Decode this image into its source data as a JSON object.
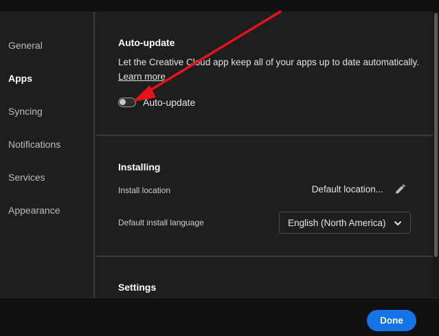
{
  "sidebar": {
    "items": [
      {
        "label": "General",
        "active": false
      },
      {
        "label": "Apps",
        "active": true
      },
      {
        "label": "Syncing",
        "active": false
      },
      {
        "label": "Notifications",
        "active": false
      },
      {
        "label": "Services",
        "active": false
      },
      {
        "label": "Appearance",
        "active": false
      }
    ]
  },
  "auto_update": {
    "title": "Auto-update",
    "description": "Let the Creative Cloud app keep all of your apps up to date automatically.",
    "learn_more": "Learn more",
    "toggle_label": "Auto-update",
    "toggle_on": false
  },
  "installing": {
    "title": "Installing",
    "install_location_label": "Install location",
    "install_location_value": "Default location...",
    "install_language_label": "Default install language",
    "install_language_value": "English (North America)"
  },
  "settings": {
    "title": "Settings"
  },
  "footer": {
    "done_label": "Done"
  },
  "colors": {
    "accent": "#1473e6",
    "annotation_arrow": "#e8121b"
  },
  "icons": {
    "edit": "pencil-icon",
    "dropdown": "chevron-down-icon"
  }
}
